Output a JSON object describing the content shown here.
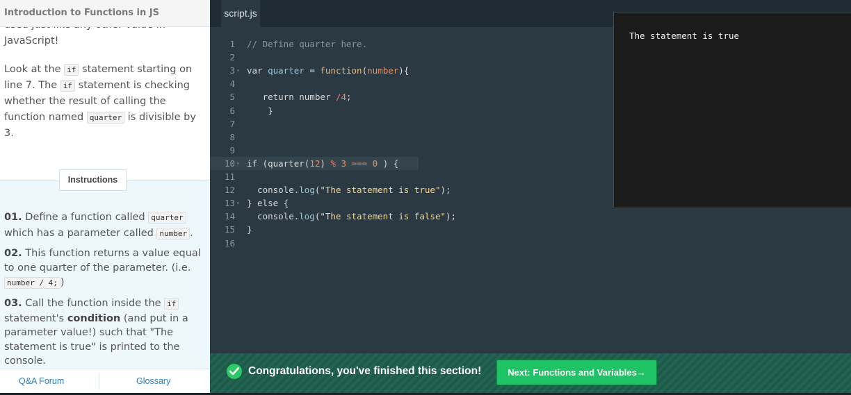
{
  "lesson": {
    "title": "Introduction to Functions in JS",
    "intro_tail": "used just like any other value in JavaScript!",
    "para": {
      "t1": "Look at the ",
      "c1": "if",
      "t2": " statement starting on line 7. The ",
      "c2": "if",
      "t3": " statement is checking whether the result of calling the function named ",
      "c3": "quarter",
      "t4": " is divisible by 3."
    },
    "instructions_tab": "Instructions",
    "steps": [
      {
        "num": "01.",
        "t1": " Define a function called ",
        "c1": "quarter",
        "t2": " which has a parameter called ",
        "c2": "number",
        "t3": "."
      },
      {
        "num": "02.",
        "t1": " This function returns a value equal to one quarter of the parameter. (i.e. ",
        "c1": "number / 4;",
        "t2": ")"
      },
      {
        "num": "03.",
        "t1": " Call the function inside the ",
        "c1": "if",
        "t2": " statement's ",
        "b1": "condition",
        "t3": " (and put in a parameter value!) such that \"The statement is true\" is printed to the console."
      }
    ],
    "footer": {
      "qa": "Q&A Forum",
      "glossary": "Glossary"
    }
  },
  "editor": {
    "tab": "script.js",
    "lines": [
      {
        "n": "1",
        "fold": "",
        "active": false,
        "tokens": [
          [
            "cm",
            "// Define quarter here."
          ]
        ]
      },
      {
        "n": "2",
        "fold": "",
        "active": false,
        "tokens": []
      },
      {
        "n": "3",
        "fold": "▾",
        "active": false,
        "tokens": [
          [
            "kw",
            "var "
          ],
          [
            "var",
            "quarter"
          ],
          [
            "kw",
            " = "
          ],
          [
            "fn",
            "function"
          ],
          [
            "kw",
            "("
          ],
          [
            "num",
            "number"
          ],
          [
            "kw",
            "){"
          ]
        ]
      },
      {
        "n": "4",
        "fold": "",
        "active": false,
        "tokens": []
      },
      {
        "n": "5",
        "fold": "",
        "active": false,
        "tokens": [
          [
            "kw",
            "   return number "
          ],
          [
            "op",
            "/"
          ],
          [
            "num",
            "4"
          ],
          [
            "kw",
            ";"
          ]
        ]
      },
      {
        "n": "6",
        "fold": "",
        "active": false,
        "tokens": [
          [
            "kw",
            "    }"
          ]
        ]
      },
      {
        "n": "7",
        "fold": "",
        "active": false,
        "tokens": []
      },
      {
        "n": "8",
        "fold": "",
        "active": false,
        "tokens": []
      },
      {
        "n": "9",
        "fold": "",
        "active": false,
        "tokens": []
      },
      {
        "n": "10",
        "fold": "▾",
        "active": true,
        "tokens": [
          [
            "kw",
            "if (quarter("
          ],
          [
            "num",
            "12"
          ],
          [
            "kw",
            ") "
          ],
          [
            "op",
            "%"
          ],
          [
            "kw",
            " "
          ],
          [
            "num",
            "3"
          ],
          [
            "kw",
            " "
          ],
          [
            "op",
            "==="
          ],
          [
            "kw",
            " "
          ],
          [
            "num",
            "0"
          ],
          [
            "kw",
            " ) {"
          ]
        ]
      },
      {
        "n": "11",
        "fold": "",
        "active": false,
        "tokens": []
      },
      {
        "n": "12",
        "fold": "",
        "active": false,
        "tokens": [
          [
            "kw",
            "  console."
          ],
          [
            "prop",
            "log"
          ],
          [
            "kw",
            "("
          ],
          [
            "str",
            "\"The statement is true\""
          ],
          [
            "kw",
            ");"
          ]
        ]
      },
      {
        "n": "13",
        "fold": "▾",
        "active": false,
        "tokens": [
          [
            "kw",
            "} else {"
          ]
        ]
      },
      {
        "n": "14",
        "fold": "",
        "active": false,
        "tokens": [
          [
            "kw",
            "  console."
          ],
          [
            "prop",
            "log"
          ],
          [
            "kw",
            "("
          ],
          [
            "str",
            "\"The statement is false\""
          ],
          [
            "kw",
            ");"
          ]
        ]
      },
      {
        "n": "15",
        "fold": "",
        "active": false,
        "tokens": [
          [
            "kw",
            "}"
          ]
        ]
      },
      {
        "n": "16",
        "fold": "",
        "active": false,
        "tokens": []
      }
    ]
  },
  "console": {
    "output": "The statement is true"
  },
  "congrats": {
    "message": "Congratulations, you've finished this section!",
    "next_button": "Next: Functions and Variables→"
  },
  "colors": {
    "accent_green": "#1fc365",
    "banner_bg": "#1d5e4c",
    "editor_bg": "#2b3a42"
  }
}
